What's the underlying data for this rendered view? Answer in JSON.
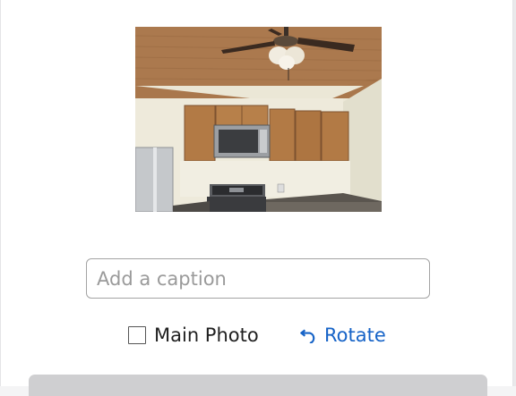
{
  "photo": {
    "subject": "kitchen"
  },
  "caption": {
    "placeholder": "Add a caption",
    "value": ""
  },
  "options": {
    "main_photo_label": "Main Photo",
    "main_photo_checked": false,
    "rotate_label": "Rotate"
  },
  "colors": {
    "accent": "#1663c7",
    "bottom_bar": "#cfcfd1"
  }
}
